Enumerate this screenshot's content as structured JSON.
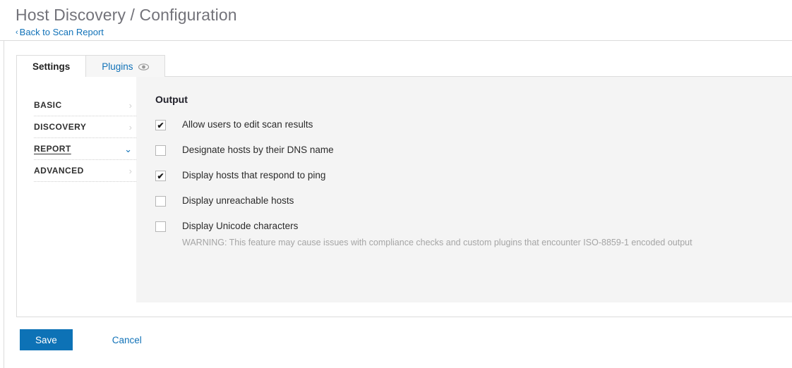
{
  "header": {
    "title": "Host Discovery / Configuration",
    "back_link": "Back to Scan Report",
    "back_chevron": "‹"
  },
  "tabs": [
    {
      "label": "Settings",
      "active": true,
      "icon": null
    },
    {
      "label": "Plugins",
      "active": false,
      "icon": "eye-icon"
    }
  ],
  "side_nav": {
    "items": [
      {
        "label": "BASIC",
        "active": false,
        "icon": "chevron-right-icon",
        "glyph": "›"
      },
      {
        "label": "DISCOVERY",
        "active": false,
        "icon": "chevron-right-icon",
        "glyph": "›"
      },
      {
        "label": "REPORT",
        "active": true,
        "icon": "chevron-down-icon",
        "glyph": "⌄"
      },
      {
        "label": "ADVANCED",
        "active": false,
        "icon": "chevron-right-icon",
        "glyph": "›"
      }
    ]
  },
  "content": {
    "section_title": "Output",
    "options": [
      {
        "label": "Allow users to edit scan results",
        "checked": true,
        "warning": null
      },
      {
        "label": "Designate hosts by their DNS name",
        "checked": false,
        "warning": null
      },
      {
        "label": "Display hosts that respond to ping",
        "checked": true,
        "warning": null
      },
      {
        "label": "Display unreachable hosts",
        "checked": false,
        "warning": null
      },
      {
        "label": "Display Unicode characters",
        "checked": false,
        "warning": "WARNING: This feature may cause issues with compliance checks and custom plugins that encounter ISO-8859-1 encoded output"
      }
    ],
    "check_glyph": "✔"
  },
  "footer": {
    "save_label": "Save",
    "cancel_label": "Cancel"
  },
  "colors": {
    "accent_blue": "#0d72b6",
    "link_blue": "#1172b8",
    "panel_gray": "#f4f4f4",
    "border_gray": "#dcdcdc",
    "title_gray": "#73737a"
  }
}
